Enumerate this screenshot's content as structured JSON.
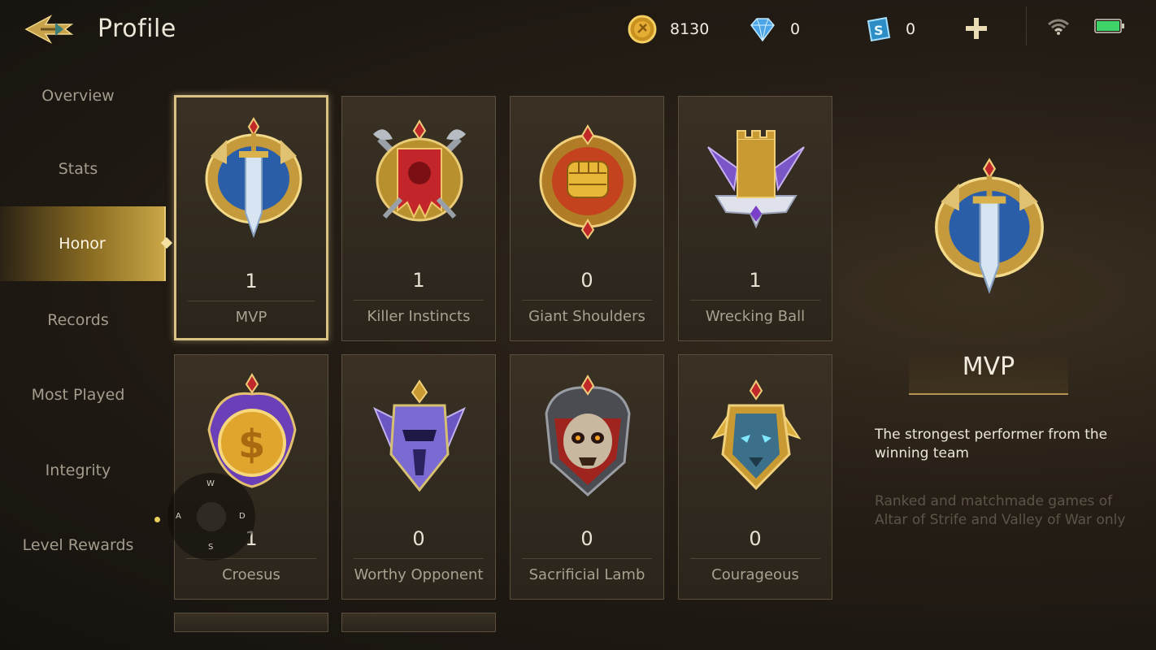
{
  "header": {
    "title": "Profile"
  },
  "currencies": [
    {
      "icon": "gold-coin-icon",
      "value": "8130"
    },
    {
      "icon": "diamond-icon",
      "value": "0"
    },
    {
      "icon": "voucher-icon",
      "value": "0"
    }
  ],
  "sidebar": {
    "items": [
      {
        "label": "Overview"
      },
      {
        "label": "Stats"
      },
      {
        "label": "Honor",
        "active": true
      },
      {
        "label": "Records"
      },
      {
        "label": "Most Played"
      },
      {
        "label": "Integrity"
      },
      {
        "label": "Level Rewards"
      }
    ]
  },
  "honors": [
    {
      "name": "MVP",
      "count": "1",
      "icon": "mvp-badge-icon",
      "selected": true
    },
    {
      "name": "Killer Instincts",
      "count": "1",
      "icon": "killer-instincts-badge-icon"
    },
    {
      "name": "Giant Shoulders",
      "count": "0",
      "icon": "giant-shoulders-badge-icon"
    },
    {
      "name": "Wrecking Ball",
      "count": "1",
      "icon": "wrecking-ball-badge-icon"
    },
    {
      "name": "Croesus",
      "count": "1",
      "icon": "croesus-badge-icon"
    },
    {
      "name": "Worthy Opponent",
      "count": "0",
      "icon": "worthy-opponent-badge-icon"
    },
    {
      "name": "Sacrificial Lamb",
      "count": "0",
      "icon": "sacrificial-lamb-badge-icon"
    },
    {
      "name": "Courageous",
      "count": "0",
      "icon": "courageous-badge-icon"
    }
  ],
  "detail": {
    "title": "MVP",
    "description": "The strongest performer from the winning team",
    "note": "Ranked and matchmade games of Altar of Strife and Valley of War only"
  },
  "joystick": {
    "up": "W",
    "left": "A",
    "right": "D",
    "down": "S"
  },
  "colors": {
    "accent_gold": "#d9c083",
    "battery_green": "#3fd46a"
  }
}
